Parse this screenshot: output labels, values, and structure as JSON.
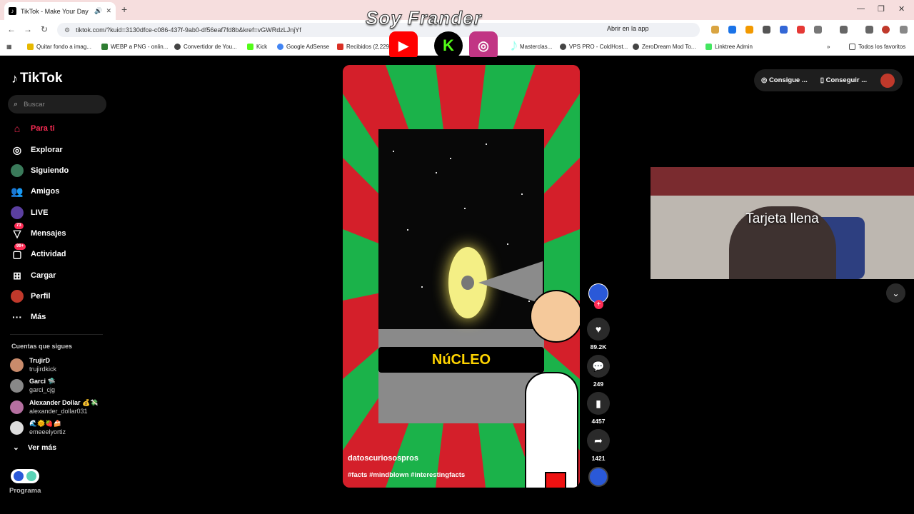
{
  "browser": {
    "tab_title": "TikTok - Make Your Day",
    "url": "tiktok.com/?kuid=3130dfce-c086-437f-9ab0-df56eaf7fd8b&kref=vGWRdzLJnjYf",
    "open_in_app": "Abrir en la app",
    "bookmarks": [
      "Quitar fondo a imag...",
      "WEBP a PNG - onlin...",
      "Convertidor de You...",
      "Kick",
      "Google AdSense",
      "Recibidos (2,229...",
      "Masterclas...",
      "VPS PRO - ColdHost...",
      "ZeroDream Mod To...",
      "Linktree Admin"
    ],
    "all_favorites": "Todos los favoritos"
  },
  "stream_overlay": {
    "title": "Soy Frander"
  },
  "tiktok": {
    "logo": "TikTok",
    "search_placeholder": "Buscar",
    "nav": [
      {
        "label": "Para ti",
        "icon": "home-icon"
      },
      {
        "label": "Explorar",
        "icon": "compass-icon"
      },
      {
        "label": "Siguiendo",
        "icon": "following-avatar-icon"
      },
      {
        "label": "Amigos",
        "icon": "friends-icon"
      },
      {
        "label": "LIVE",
        "icon": "live-icon"
      },
      {
        "label": "Mensajes",
        "icon": "messages-icon",
        "badge": "73"
      },
      {
        "label": "Actividad",
        "icon": "activity-icon",
        "badge": "99+"
      },
      {
        "label": "Cargar",
        "icon": "upload-icon"
      },
      {
        "label": "Perfil",
        "icon": "profile-icon"
      },
      {
        "label": "Más",
        "icon": "more-icon"
      }
    ],
    "following_title": "Cuentas que sigues",
    "following": [
      {
        "name": "TrujirD",
        "handle": "trujirdkick"
      },
      {
        "name": "Garci 🛸",
        "handle": "garci_cjg"
      },
      {
        "name": "Alexander Dollar 💰💸",
        "handle": "alexander_dollar031"
      },
      {
        "name": "🌊🌞🍓🍰",
        "handle": "emeeelyortiz"
      }
    ],
    "see_more": "Ver más",
    "programa": "Programa",
    "top_buttons": [
      "Consigue ...",
      "Conseguir ..."
    ]
  },
  "video": {
    "caption_word": "NúCLEO",
    "author": "datoscuriosospros",
    "tags": "#facts #mindblown #interestingfacts",
    "likes": "89.2K",
    "comments": "249",
    "saves": "4457",
    "shares": "1421"
  },
  "webcam": {
    "label": "Tarjeta llena"
  }
}
